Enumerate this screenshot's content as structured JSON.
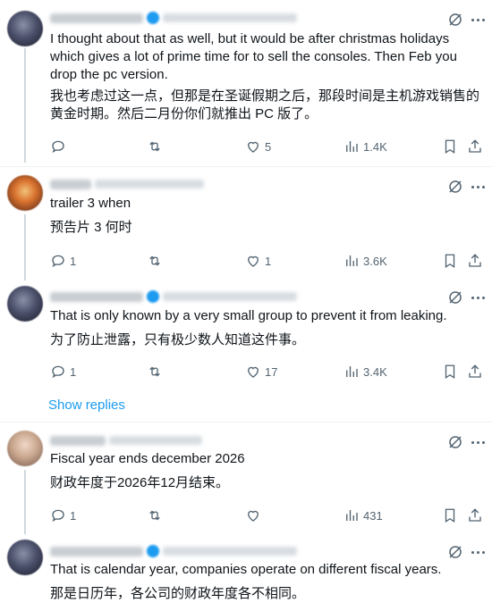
{
  "tweets": [
    {
      "text_en": "I thought about that as well, but it would be after christmas holidays which gives a lot of prime time for to sell the consoles. Then Feb you drop the pc version.",
      "text_zh": "我也考虑过这一点，但那是在圣诞假期之后，那段时间是主机游戏销售的黄金时期。然后二月份你们就推出 PC 版了。",
      "replies": "",
      "retweets": "",
      "likes": "5",
      "views": "1.4K"
    },
    {
      "text_en": "trailer 3 when",
      "text_zh": "预告片 3 何时",
      "replies": "1",
      "retweets": "",
      "likes": "1",
      "views": "3.6K"
    },
    {
      "text_en": "That is only known by a very small group to prevent it from leaking.",
      "text_zh": "为了防止泄露，只有极少数人知道这件事。",
      "replies": "1",
      "retweets": "",
      "likes": "17",
      "views": "3.4K"
    },
    {
      "text_en": "Fiscal year ends december 2026",
      "text_zh": "财政年度于2026年12月结束。",
      "replies": "1",
      "retweets": "",
      "likes": "",
      "views": "431"
    },
    {
      "text_en": "That is calendar year, companies operate on different fiscal years.",
      "text_zh": "那是日历年，各公司的财政年度各不相同。"
    }
  ],
  "show_replies": "Show replies",
  "colors": {
    "accent": "#1d9bf0",
    "muted": "#536471",
    "text": "#0f1419",
    "divider": "#eff3f4"
  }
}
